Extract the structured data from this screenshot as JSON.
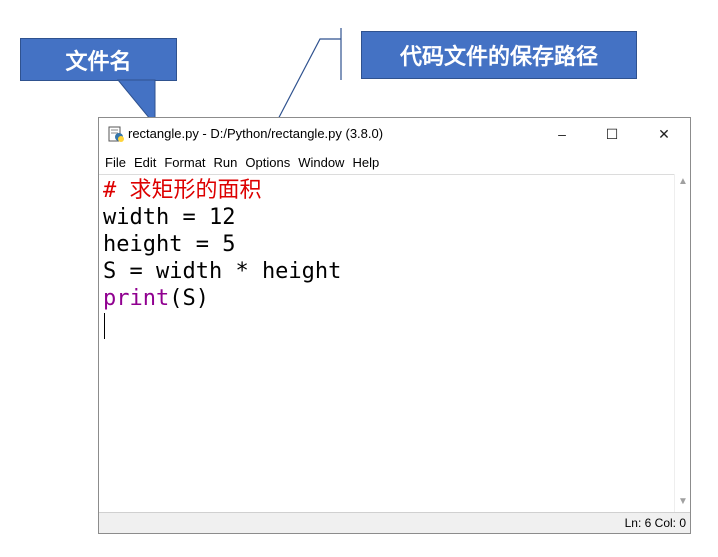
{
  "callouts": {
    "filename_label": "文件名",
    "path_label": "代码文件的保存路径"
  },
  "window": {
    "title": "rectangle.py - D:/Python/rectangle.py (3.8.0)",
    "app_icon": "python-idle-icon",
    "controls": {
      "minimize": "–",
      "maximize": "☐",
      "close": "✕"
    }
  },
  "menu": [
    "File",
    "Edit",
    "Format",
    "Run",
    "Options",
    "Window",
    "Help"
  ],
  "code": {
    "line1": "# 求矩形的面积",
    "line2": "width = 12",
    "line3": "height = 5",
    "line4": "S = width * height",
    "line5_keyword": "print",
    "line5_rest": "(S)"
  },
  "status": {
    "position": "Ln: 6  Col: 0"
  },
  "colors": {
    "callout_bg": "#4472c4",
    "comment": "#dd0000",
    "keyword": "#900090"
  }
}
